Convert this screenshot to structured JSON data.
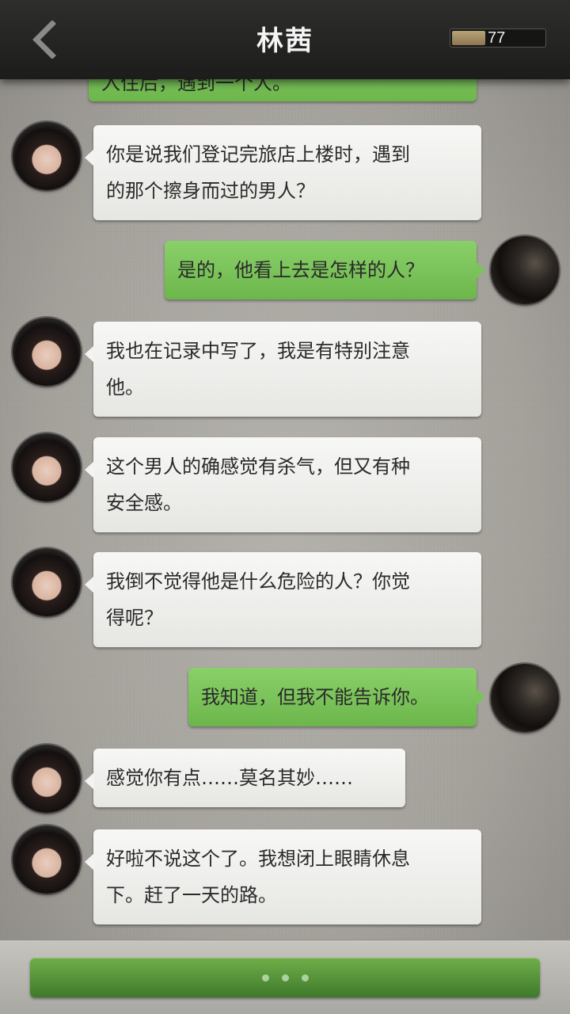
{
  "header": {
    "title": "林茜",
    "energy_value": "77",
    "energy_fraction": 0.36
  },
  "messages": [
    {
      "side": "right",
      "text": "入住后，遇到一个人。"
    },
    {
      "side": "left",
      "avatar": "girl-avatar",
      "lines": [
        "你是说我们登记完旅店上楼时，遇到",
        "的那个擦身而过的男人？"
      ]
    },
    {
      "side": "right",
      "avatar": "player-avatar",
      "lines": [
        "是的，他看上去是怎样的人？"
      ]
    },
    {
      "side": "left",
      "avatar": "girl-avatar",
      "lines": [
        "我也在记录中写了，我是有特别注意",
        "他。"
      ]
    },
    {
      "side": "left",
      "avatar": "girl-avatar",
      "lines": [
        "这个男人的确感觉有杀气，但又有种",
        "安全感。"
      ]
    },
    {
      "side": "left",
      "avatar": "girl-avatar",
      "lines": [
        "我倒不觉得他是什么危险的人？你觉",
        "得呢？"
      ]
    },
    {
      "side": "right",
      "avatar": "player-avatar",
      "lines": [
        "我知道，但我不能告诉你。"
      ]
    },
    {
      "side": "left",
      "avatar": "girl-avatar",
      "lines": [
        "感觉你有点……莫名其妙……"
      ]
    },
    {
      "side": "left",
      "avatar": "girl-avatar",
      "lines": [
        "好啦不说这个了。我想闭上眼睛休息",
        "下。赶了一天的路。"
      ]
    }
  ],
  "footer": {
    "typing_indicator": "dots"
  },
  "colors": {
    "header_bg": "#232322",
    "bubble_left": "#f0f0ee",
    "bubble_right": "#7cc25b",
    "action_bar": "#58943a"
  }
}
